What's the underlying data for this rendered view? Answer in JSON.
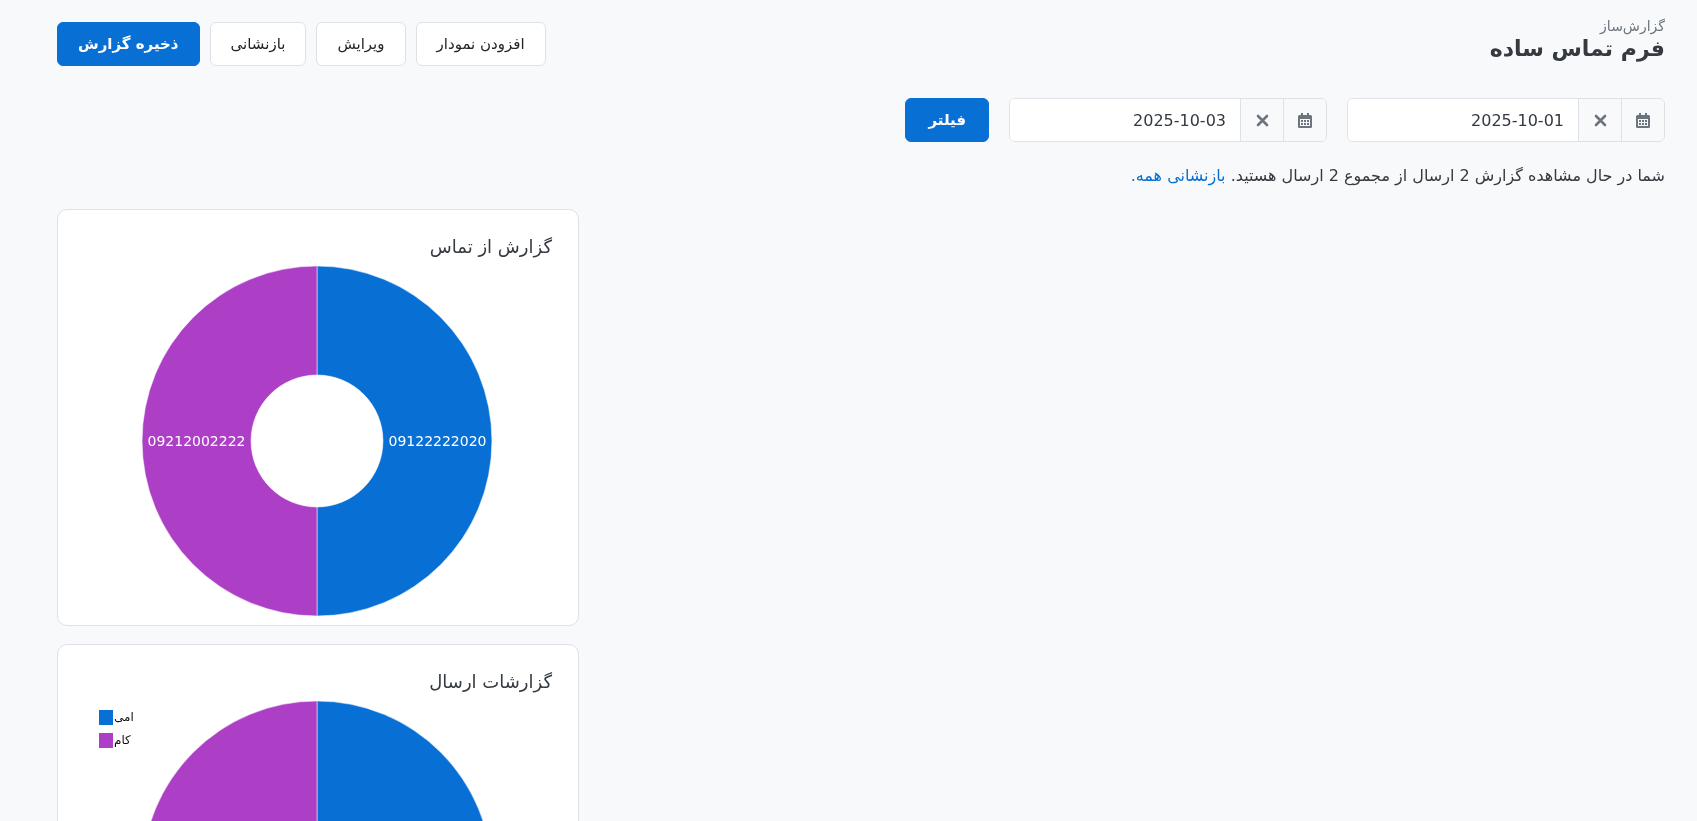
{
  "header": {
    "subtitle": "گزارش‌ساز",
    "title": "فرم تماس ساده"
  },
  "actions": [
    {
      "label": "افزودن نمودار",
      "kind": "secondary"
    },
    {
      "label": "ویرایش",
      "kind": "secondary"
    },
    {
      "label": "بازنشانی",
      "kind": "secondary"
    },
    {
      "label": "ذخیره گزارش",
      "kind": "primary"
    }
  ],
  "date_filters": [
    {
      "value": "2025-10-01"
    },
    {
      "value": "2025-10-03"
    }
  ],
  "filter_button": "فیلتر",
  "summary": {
    "text": "شما در حال مشاهده گزارش 2 ارسال از مجموع 2 ارسال هستید.",
    "link": "بازنشانی همه."
  },
  "charts": [
    {
      "title": "گزارش از تماس",
      "kind": "slice-labels",
      "chart_data": {
        "type": "donut",
        "categories": [
          "09122222020",
          "09212002222"
        ],
        "values": [
          50,
          50
        ]
      }
    },
    {
      "title": "گزارشات ارسال",
      "kind": "legend",
      "chart_data": {
        "type": "pie",
        "categories": [
          "امی",
          "کام"
        ],
        "values": [
          50,
          50
        ],
        "legend": "top-left"
      }
    }
  ]
}
